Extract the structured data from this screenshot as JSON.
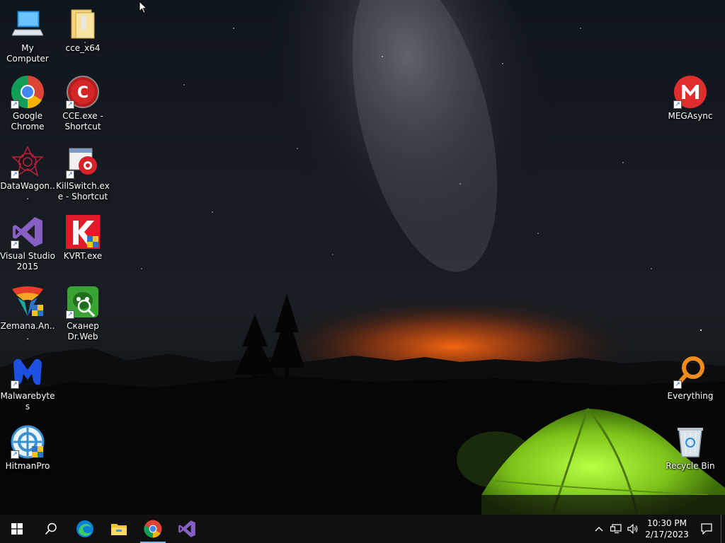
{
  "desktop": {
    "icons": [
      {
        "id": "my-computer",
        "label": "My Computer"
      },
      {
        "id": "cce-x64",
        "label": "cce_x64"
      },
      {
        "id": "google-chrome",
        "label": "Google Chrome"
      },
      {
        "id": "cce-shortcut",
        "label": "CCE.exe - Shortcut"
      },
      {
        "id": "datawagon",
        "label": "DataWagon..."
      },
      {
        "id": "killswitch",
        "label": "KillSwitch.exe - Shortcut"
      },
      {
        "id": "visual-studio",
        "label": "Visual Studio 2015"
      },
      {
        "id": "kvrt",
        "label": "KVRT.exe"
      },
      {
        "id": "zemana",
        "label": "Zemana.An..."
      },
      {
        "id": "drweb",
        "label": "Сканер Dr.Web"
      },
      {
        "id": "malwarebytes",
        "label": "Malwarebytes"
      },
      {
        "id": "hitmanpro",
        "label": "HitmanPro"
      },
      {
        "id": "megasync",
        "label": "MEGAsync"
      },
      {
        "id": "everything",
        "label": "Everything"
      },
      {
        "id": "recycle-bin",
        "label": "Recycle Bin"
      }
    ]
  },
  "taskbar": {
    "apps": [
      "start-icon",
      "search-icon",
      "edge-icon",
      "file-explorer-icon",
      "chrome-icon",
      "visual-studio-icon"
    ],
    "clock": {
      "time": "10:30 PM",
      "date": "2/17/2023"
    }
  },
  "colors": {
    "taskbar": "#101010",
    "accent": "#76b9ed",
    "tent": "#8ee02a"
  }
}
